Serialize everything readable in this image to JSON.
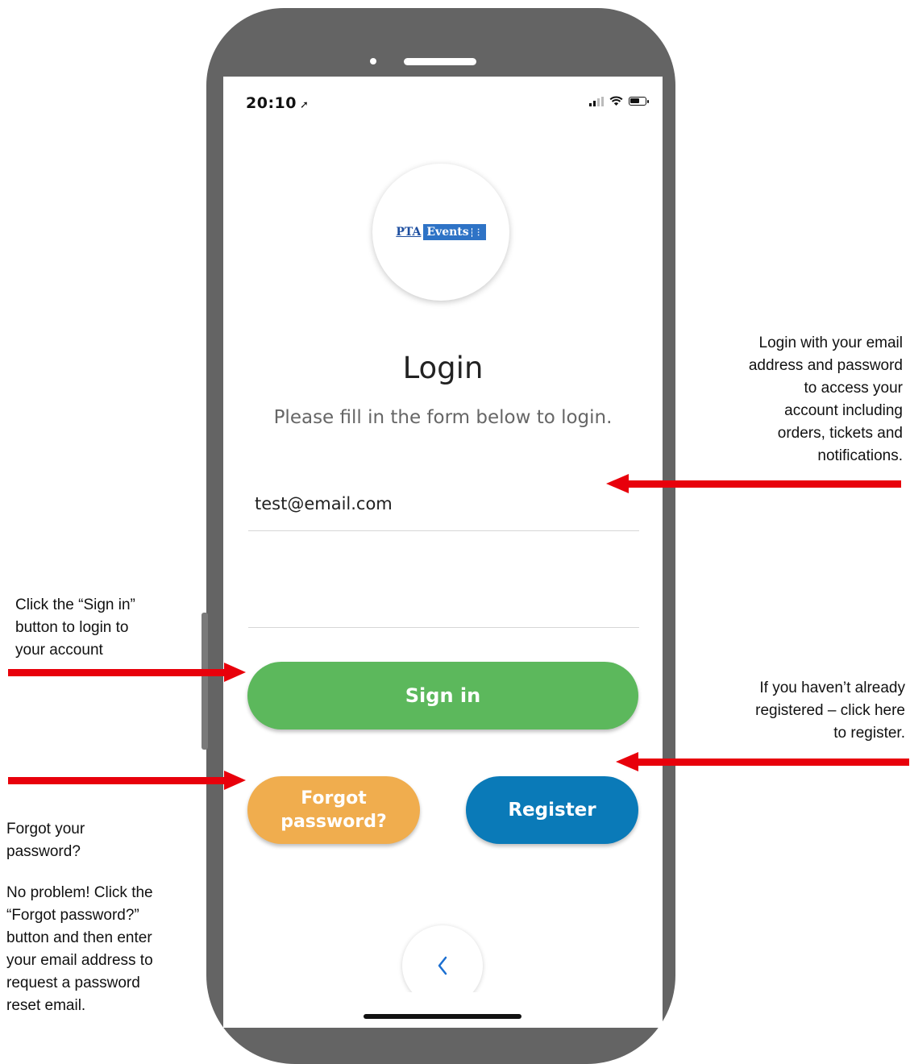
{
  "status_bar": {
    "time": "20:10",
    "location_glyph": "➚"
  },
  "logo": {
    "pta": "PTA",
    "events": "Events"
  },
  "login": {
    "title": "Login",
    "subtitle": "Please fill in the form below to login.",
    "email_value": "test@email.com",
    "password_value": ""
  },
  "buttons": {
    "sign_in": "Sign in",
    "forgot_line1": "Forgot",
    "forgot_line2": "password?",
    "register": "Register",
    "back_icon": "chevron-left-icon"
  },
  "annotations": {
    "login_note": [
      "Login with your email",
      "address and password",
      "to access your",
      "account including",
      "orders, tickets and",
      "notifications."
    ],
    "signin_note": [
      "Click the “Sign in”",
      "button to login to",
      "your account"
    ],
    "register_note": [
      "If you haven’t already",
      "registered – click here",
      "to register."
    ],
    "forgot_note_a": [
      "Forgot your",
      "password?"
    ],
    "forgot_note_b": [
      "No problem! Click the",
      "“Forgot password?”",
      "button and then enter",
      "your email address to",
      "request a password",
      "reset email."
    ]
  },
  "colors": {
    "arrow": "#e8000b",
    "sign_in": "#5cb85c",
    "forgot": "#f0ad4e",
    "register": "#0a7ab8",
    "frame": "#646464"
  }
}
